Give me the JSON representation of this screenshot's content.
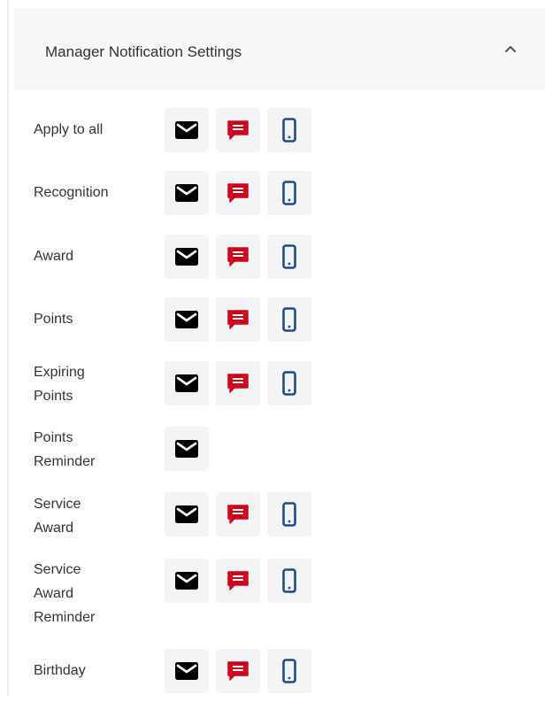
{
  "panel": {
    "title": "Manager Notification Settings",
    "collapse_icon": "chevron-up-icon"
  },
  "colors": {
    "email": "#000000",
    "sms": "#d0021b",
    "mobile": "#1f4b86",
    "bell": "#1e3057"
  },
  "rows": [
    {
      "label": "Apply to all",
      "channels": [
        "email",
        "sms",
        "mobile"
      ]
    },
    {
      "label": "Recognition",
      "channels": [
        "email",
        "sms",
        "mobile"
      ]
    },
    {
      "label": "Award",
      "channels": [
        "email",
        "sms",
        "mobile"
      ]
    },
    {
      "label": "Points",
      "channels": [
        "email",
        "sms",
        "mobile"
      ]
    },
    {
      "label": "Expiring Points",
      "channels": [
        "email",
        "sms",
        "mobile"
      ]
    },
    {
      "label": "Points Reminder",
      "channels": [
        "email"
      ]
    },
    {
      "label": "Service Award",
      "channels": [
        "email",
        "sms",
        "mobile"
      ]
    },
    {
      "label": "Service Award Reminder",
      "channels": [
        "email",
        "sms",
        "mobile"
      ]
    },
    {
      "label": "Birthday",
      "channels": [
        "email",
        "sms",
        "mobile"
      ]
    }
  ],
  "icons": {
    "email": "envelope-icon",
    "sms": "message-icon",
    "mobile": "smartphone-icon",
    "background": "bell-icon"
  }
}
